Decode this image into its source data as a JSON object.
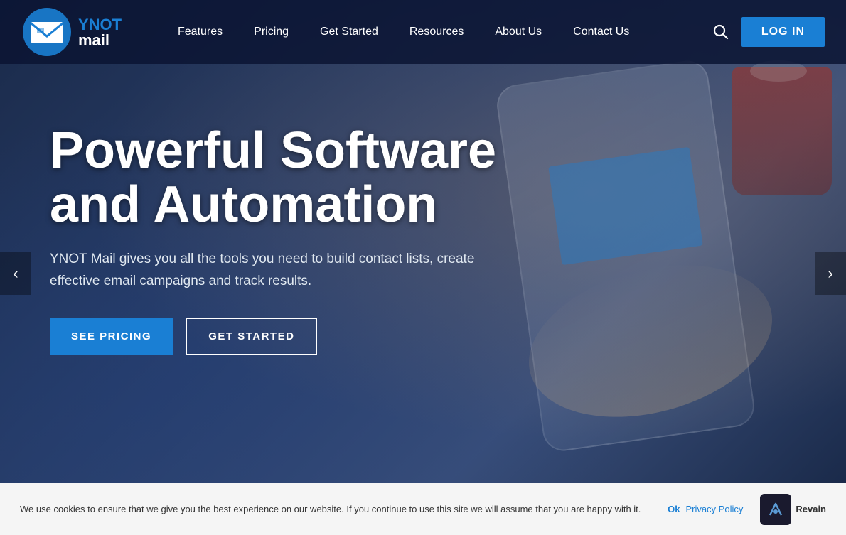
{
  "brand": {
    "name_top": "YNOT",
    "name_bottom": "mail"
  },
  "nav": {
    "links": [
      {
        "id": "features",
        "label": "Features"
      },
      {
        "id": "pricing",
        "label": "Pricing"
      },
      {
        "id": "get-started",
        "label": "Get Started"
      },
      {
        "id": "resources",
        "label": "Resources"
      },
      {
        "id": "about-us",
        "label": "About Us"
      },
      {
        "id": "contact-us",
        "label": "Contact Us"
      }
    ],
    "login_label": "LOG IN"
  },
  "hero": {
    "title_line1": "Powerful Software",
    "title_line2": "and Automation",
    "subtitle": "YNOT Mail gives you all the tools you need to build contact lists, create effective email campaigns and track results.",
    "btn_pricing": "SEE PRICING",
    "btn_get_started": "GET STARTED"
  },
  "carousel": {
    "prev_label": "‹",
    "next_label": "›"
  },
  "cookie": {
    "text": "We use cookies to ensure that we give you the best experience on our website. If you continue to use this site we will assume that you are happy with it.",
    "ok_label": "Ok",
    "privacy_label": "Privacy Policy"
  },
  "revain": {
    "label": "Revain"
  }
}
